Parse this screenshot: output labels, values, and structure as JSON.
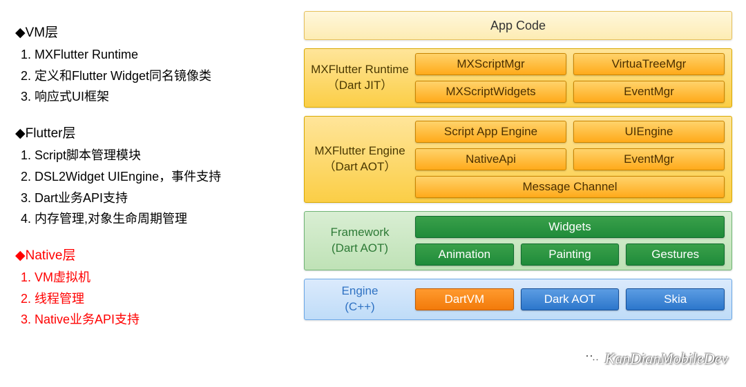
{
  "left": {
    "vm": {
      "title": "VM层",
      "items": [
        "MXFlutter Runtime",
        "定义和Flutter Widget同名镜像类",
        "响应式UI框架"
      ]
    },
    "flutter": {
      "title": "Flutter层",
      "items": [
        "Script脚本管理模块",
        "DSL2Widget UIEngine，事件支持",
        "Dart业务API支持",
        "内存管理,对象生命周期管理"
      ]
    },
    "native": {
      "title": "Native层",
      "items": [
        "VM虚拟机",
        "线程管理",
        "Native业务API支持"
      ]
    }
  },
  "right": {
    "appcode": "App Code",
    "runtime": {
      "label_l1": "MXFlutter Runtime",
      "label_l2": "（Dart JIT）",
      "row1": [
        "MXScriptMgr",
        "VirtuaTreeMgr"
      ],
      "row2": [
        "MXScriptWidgets",
        "EventMgr"
      ]
    },
    "engine": {
      "label_l1": "MXFlutter Engine",
      "label_l2": "（Dart AOT）",
      "row1": [
        "Script App Engine",
        "UIEngine"
      ],
      "row2": [
        "NativeApi",
        "EventMgr"
      ],
      "row3": [
        "Message Channel"
      ]
    },
    "framework": {
      "label_l1": "Framework",
      "label_l2": "(Dart AOT)",
      "row1": [
        "Widgets"
      ],
      "row2": [
        "Animation",
        "Painting",
        "Gestures"
      ]
    },
    "cpp": {
      "label_l1": "Engine",
      "label_l2": "(C++)",
      "row1": [
        "DartVM",
        "Dark AOT",
        "Skia"
      ]
    }
  },
  "watermark": "KanDianMobileDev"
}
